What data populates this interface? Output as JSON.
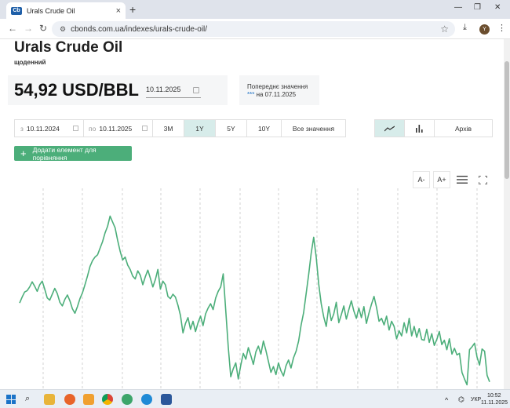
{
  "browser": {
    "tab_title": "Urals Crude Oil",
    "url": "cbonds.com.ua/indexes/urals-crude-oil/",
    "avatar_letter": "Y",
    "favicon_text": "Cb"
  },
  "header": {
    "title": "Urals Crude Oil",
    "frequency": "щоденний",
    "value": "54,92 USD/BBL",
    "date": "10.11.2025",
    "prev_label": "Попереднє значення",
    "prev_stars": "***",
    "prev_date": "на 07.11.2025"
  },
  "controls": {
    "from_prefix": "з",
    "from_date": "10.11.2024",
    "to_prefix": "по",
    "to_date": "10.11.2025",
    "periods": [
      "3M",
      "1Y",
      "5Y",
      "10Y",
      "Все значення"
    ],
    "active_period": "1Y",
    "archive_label": "Архів",
    "add_compare_label": "Додати елемент для порівняння"
  },
  "chart_tools": {
    "font_minus": "A-",
    "font_plus": "A+"
  },
  "colors": {
    "line": "#4cae7a",
    "button": "#4cae7a",
    "active": "#d7ecea"
  },
  "chart_data": {
    "type": "line",
    "series": [
      {
        "values": [
          62.3,
          63.1,
          63.8,
          64.0,
          64.5,
          65.2,
          64.6,
          63.9,
          64.8,
          65.3,
          64.2,
          63.0,
          62.7,
          63.5,
          64.3,
          63.6,
          62.4,
          61.9,
          62.8,
          63.4,
          62.6,
          61.5,
          60.9,
          61.8,
          62.9,
          63.7,
          64.8,
          66.0,
          67.3,
          68.1,
          68.6,
          68.9,
          69.8,
          70.7,
          71.9,
          72.8,
          74.2,
          73.4,
          72.6,
          70.9,
          69.4,
          68.2,
          68.6,
          67.5,
          66.9,
          66.0,
          65.6,
          66.7,
          66.1,
          64.8,
          65.9,
          66.8,
          65.7,
          64.5,
          65.5,
          66.9,
          64.2,
          65.3,
          64.8,
          63.2,
          62.9,
          63.5,
          63.1,
          62.0,
          60.6,
          58.2,
          59.5,
          60.3,
          58.7,
          59.8,
          58.4,
          59.6,
          60.5,
          59.2,
          60.8,
          61.6,
          62.2,
          61.4,
          63.0,
          63.9,
          64.5,
          66.3,
          61.3,
          56.3,
          52.2,
          53.3,
          54.1,
          51.9,
          53.8,
          55.4,
          54.6,
          56.2,
          55.1,
          53.9,
          55.6,
          56.4,
          55.3,
          57.1,
          55.8,
          54.3,
          52.8,
          53.6,
          52.5,
          54.1,
          53.0,
          52.3,
          53.7,
          54.5,
          53.4,
          54.8,
          55.7,
          57.1,
          59.3,
          61.0,
          63.6,
          66.2,
          69.1,
          71.3,
          68.6,
          64.9,
          62.2,
          60.4,
          59.1,
          61.8,
          59.9,
          60.8,
          62.4,
          59.6,
          60.7,
          61.9,
          60.1,
          61.4,
          62.6,
          61.2,
          60.2,
          61.6,
          60.3,
          61.8,
          59.5,
          60.9,
          62.1,
          63.2,
          61.7,
          59.8,
          60.2,
          59.3,
          60.5,
          58.6,
          59.8,
          59.1,
          57.4,
          58.5,
          57.8,
          59.6,
          58.2,
          60.2,
          57.8,
          59.1,
          57.6,
          58.8,
          57.3,
          57.2,
          58.7,
          56.9,
          58.1,
          56.5,
          57.3,
          58.4,
          56.6,
          57.2,
          55.9,
          57.4,
          55.3,
          56.1,
          55.2,
          55.4,
          52.8,
          51.9,
          51.1,
          55.9,
          56.3,
          56.8,
          54.9,
          53.8,
          56.0,
          55.7,
          52.4,
          51.5
        ]
      }
    ],
    "x_range": [
      "10.11.2024",
      "10.11.2025"
    ],
    "grid": "vertical-dashed",
    "legend": "none"
  }
}
